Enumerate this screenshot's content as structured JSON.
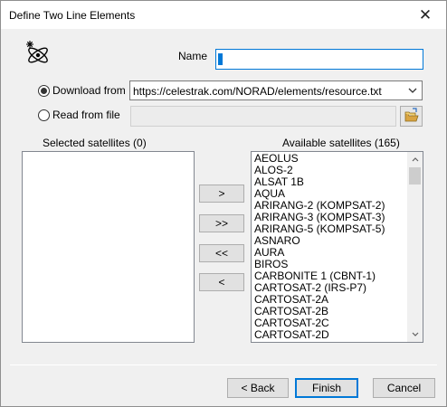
{
  "window": {
    "title": "Define Two Line Elements",
    "close_glyph": "✕"
  },
  "icons": {
    "app": "atom-icon",
    "browse": "open-folder-icon",
    "dropdown": "chevron-down-icon"
  },
  "name_field": {
    "label": "Name",
    "value": ""
  },
  "source": {
    "download_label": "Download from",
    "download_selected": true,
    "download_url": "https://celestrak.com/NORAD/elements/resource.txt",
    "file_label": "Read from file",
    "file_selected": false,
    "file_path": ""
  },
  "selected_satellites": {
    "header": "Selected satellites (0)",
    "items": []
  },
  "available_satellites": {
    "header": "Available satellites (165)",
    "items": [
      "AEOLUS",
      "ALOS-2",
      "ALSAT 1B",
      "AQUA",
      "ARIRANG-2 (KOMPSAT-2)",
      "ARIRANG-3 (KOMPSAT-3)",
      "ARIRANG-5 (KOMPSAT-5)",
      "ASNARO",
      "AURA",
      "BIROS",
      "CARBONITE 1 (CBNT-1)",
      "CARTOSAT-2 (IRS-P7)",
      "CARTOSAT-2A",
      "CARTOSAT-2B",
      "CARTOSAT-2C",
      "CARTOSAT-2D"
    ]
  },
  "move_buttons": {
    "add_one": ">",
    "add_all": ">>",
    "remove_all": "<<",
    "remove_one": "<"
  },
  "footer": {
    "back_label": "< Back",
    "finish_label": "Finish",
    "cancel_label": "Cancel"
  },
  "colors": {
    "accent": "#0078d7",
    "window_bg": "#f0f0f0"
  }
}
